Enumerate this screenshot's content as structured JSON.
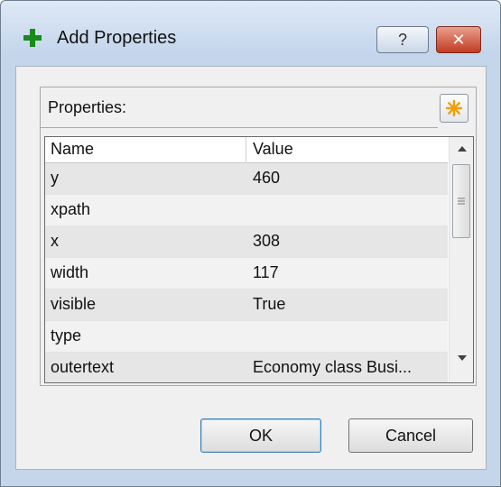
{
  "window": {
    "title": "Add Properties",
    "icon": "green-plus-icon",
    "help_label": "?",
    "close_label": "✕"
  },
  "properties": {
    "label": "Properties:",
    "add_icon": "asterisk-icon",
    "columns": [
      "Name",
      "Value"
    ],
    "rows": [
      {
        "name": "y",
        "value": "460"
      },
      {
        "name": "xpath",
        "value": ""
      },
      {
        "name": "x",
        "value": "308"
      },
      {
        "name": "width",
        "value": "117"
      },
      {
        "name": "visible",
        "value": "True"
      },
      {
        "name": "type",
        "value": ""
      },
      {
        "name": "outertext",
        "value": "Economy class  Busi..."
      }
    ]
  },
  "buttons": {
    "ok": "OK",
    "cancel": "Cancel"
  },
  "colors": {
    "accent_green": "#1a8a1a",
    "close_red": "#c23b21",
    "add_star": "#f0a000"
  }
}
